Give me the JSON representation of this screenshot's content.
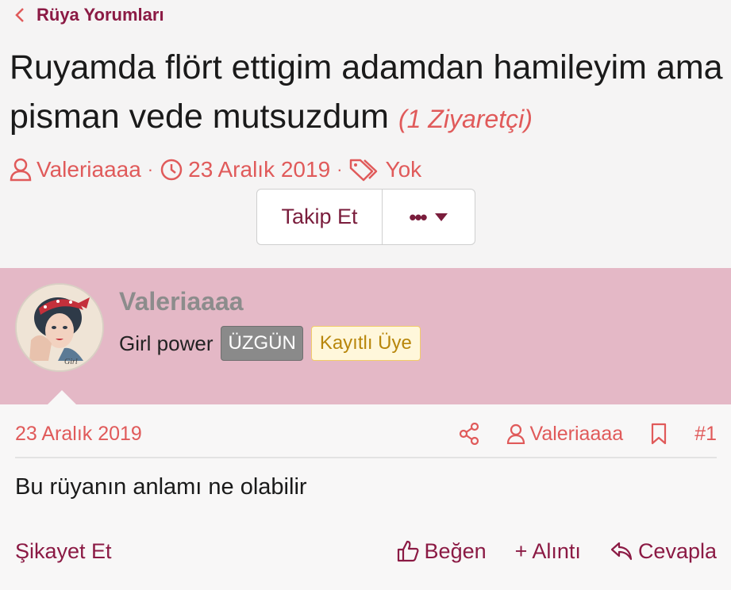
{
  "breadcrumb": {
    "label": "Rüya Yorumları"
  },
  "thread": {
    "title": "Ruyamda flört ettigim adamdan hamileyim ama pisman vede mutsuzdum",
    "visitors": "(1 Ziyaretçi)",
    "author": "Valeriaaaa",
    "date": "23 Aralık 2019",
    "tags": "Yok",
    "separator": "·"
  },
  "buttons": {
    "follow": "Takip Et",
    "more": "•••"
  },
  "user": {
    "name": "Valeriaaaa",
    "title": "Girl power",
    "mood_badge": "ÜZGÜN",
    "role_badge": "Kayıtlı Üye"
  },
  "post": {
    "date": "23 Aralık 2019",
    "author": "Valeriaaaa",
    "number": "#1",
    "body": "Bu rüyanın anlamı ne olabilir",
    "report": "Şikayet Et",
    "like": "Beğen",
    "quote": "+ Alıntı",
    "reply": "Cevapla"
  },
  "colors": {
    "accent": "#8b1a44",
    "meta": "#e05a5a",
    "band": "#e4b8c6"
  }
}
